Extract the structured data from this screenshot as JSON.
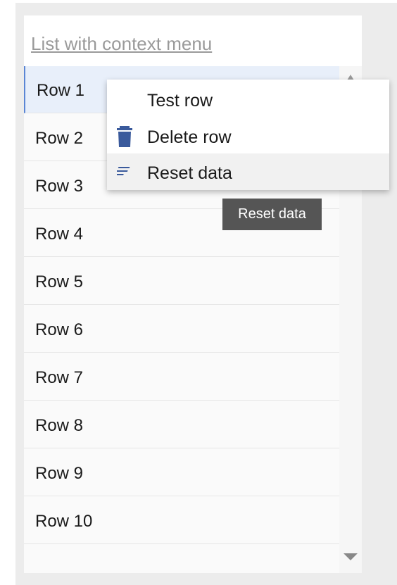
{
  "list": {
    "title": "List with context menu",
    "rows": [
      {
        "label": "Row 1"
      },
      {
        "label": "Row 2"
      },
      {
        "label": "Row 3"
      },
      {
        "label": "Row 4"
      },
      {
        "label": "Row 5"
      },
      {
        "label": "Row 6"
      },
      {
        "label": "Row 7"
      },
      {
        "label": "Row 8"
      },
      {
        "label": "Row 9"
      },
      {
        "label": "Row 10"
      }
    ],
    "selected_row": "Row 1"
  },
  "context_menu": {
    "items": [
      {
        "label": "Test row",
        "icon": "none"
      },
      {
        "label": "Delete row",
        "icon": "trash-icon"
      },
      {
        "label": "Reset data",
        "icon": "lines-icon"
      }
    ],
    "hovered_item": "Reset data"
  },
  "tooltip": {
    "text": "Reset data"
  },
  "colors": {
    "icon": "#3a5a9c",
    "selection": "#e8effa",
    "selection_border": "#5b86d4",
    "tooltip_bg": "#555555"
  }
}
